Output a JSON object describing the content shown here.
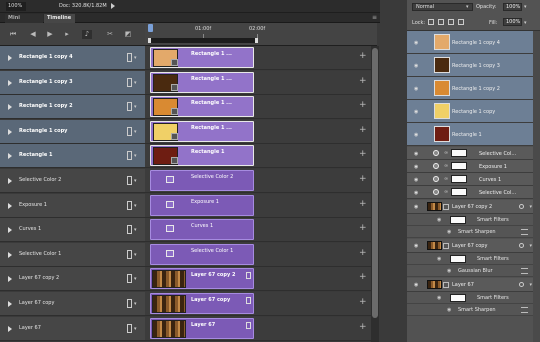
{
  "status": {
    "zoom": "100%",
    "doc": "Doc: 320.8K/1.82M"
  },
  "tabs": [
    {
      "label": "Mini Bridge"
    },
    {
      "label": "Timeline"
    }
  ],
  "controls": [
    "first-frame",
    "prev-frame",
    "play",
    "next-frame",
    "audio",
    "split",
    "transition"
  ],
  "ruler": {
    "labels": [
      "01:00f",
      "02:00f"
    ]
  },
  "tracks": [
    {
      "name": "Rectangle 1 copy 4",
      "selected": true,
      "clip": "Rectangle 1 ...",
      "kind": "rect",
      "color": "#e3a96a"
    },
    {
      "name": "Rectangle 1 copy 3",
      "selected": true,
      "clip": "Rectangle 1 ...",
      "kind": "rect",
      "color": "#4a2a0f"
    },
    {
      "name": "Rectangle 1 copy 2",
      "selected": true,
      "clip": "Rectangle 1 ...",
      "kind": "rect",
      "color": "#d98a32"
    },
    {
      "name": "Rectangle 1 copy",
      "selected": true,
      "clip": "Rectangle 1 ...",
      "kind": "rect",
      "color": "#f0d067"
    },
    {
      "name": "Rectangle 1",
      "selected": true,
      "clip": "Rectangle 1",
      "kind": "rect",
      "color": "#6e1d12"
    },
    {
      "name": "Selective Color 2",
      "selected": false,
      "clip": "Selective Color 2",
      "kind": "adj"
    },
    {
      "name": "Exposure 1",
      "selected": false,
      "clip": "Exposure 1",
      "kind": "adj"
    },
    {
      "name": "Curves 1",
      "selected": false,
      "clip": "Curves 1",
      "kind": "adj"
    },
    {
      "name": "Selective Color 1",
      "selected": false,
      "clip": "Selective Color 1",
      "kind": "adj"
    },
    {
      "name": "Layer 67 copy 2",
      "selected": false,
      "clip": "Layer 67 copy 2",
      "kind": "film"
    },
    {
      "name": "Layer 67 copy",
      "selected": false,
      "clip": "Layer 67 copy",
      "kind": "film"
    },
    {
      "name": "Layer 67",
      "selected": false,
      "clip": "Layer 67",
      "kind": "film"
    }
  ],
  "layers_panel": {
    "blend_mode": "Normal",
    "opacity_label": "Opacity:",
    "opacity": "100%",
    "lock_label": "Lock:",
    "fill_label": "Fill:",
    "fill": "100%",
    "shape_layers": [
      {
        "name": "Rectangle 1 copy 4",
        "color": "#e3a96a"
      },
      {
        "name": "Rectangle 1 copy 3",
        "color": "#4a2a0f"
      },
      {
        "name": "Rectangle 1 copy 2",
        "color": "#d98a32"
      },
      {
        "name": "Rectangle 1 copy",
        "color": "#f0d067"
      },
      {
        "name": "Rectangle 1",
        "color": "#6e1d12"
      }
    ],
    "adjustment_layers": [
      {
        "name": "Selective Col..."
      },
      {
        "name": "Exposure 1"
      },
      {
        "name": "Curves 1"
      },
      {
        "name": "Selective Col..."
      }
    ],
    "smart_layers": [
      {
        "name": "Layer 67 copy 2",
        "filters_label": "Smart Filters",
        "filter": "Smart Sharpen"
      },
      {
        "name": "Layer 67 copy",
        "filters_label": "Smart Filters",
        "filter": "Gaussian Blur"
      },
      {
        "name": "Layer 67",
        "filters_label": "Smart Filters",
        "filter": "Smart Sharpen"
      }
    ]
  }
}
